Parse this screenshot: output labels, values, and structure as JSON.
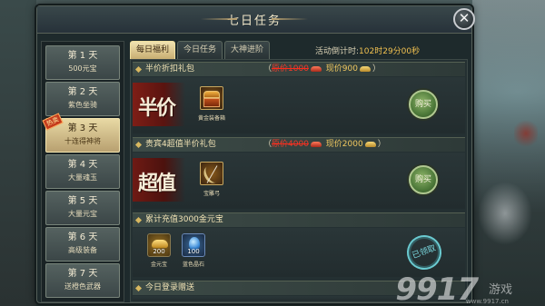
{
  "window": {
    "title": "七日任务",
    "close_symbol": "✕"
  },
  "days": [
    {
      "day": "第 1 天",
      "reward": "500元宝",
      "active": false
    },
    {
      "day": "第 2 天",
      "reward": "紫色坐骑",
      "active": false
    },
    {
      "day": "第 3 天",
      "reward": "十连得神将",
      "active": true,
      "badge": "热卖"
    },
    {
      "day": "第 4 天",
      "reward": "大量魂玉",
      "active": false
    },
    {
      "day": "第 5 天",
      "reward": "大量元宝",
      "active": false
    },
    {
      "day": "第 6 天",
      "reward": "高级装备",
      "active": false
    },
    {
      "day": "第 7 天",
      "reward": "送橙色武器",
      "active": false
    }
  ],
  "tabs": [
    {
      "label": "每日福利",
      "active": true
    },
    {
      "label": "今日任务",
      "active": false
    },
    {
      "label": "大神进阶",
      "active": false
    }
  ],
  "countdown": {
    "label": "活动倒计时:",
    "time": "102时29分00秒"
  },
  "sections": {
    "half_price": {
      "title": "半价折扣礼包",
      "paren_open": "（",
      "orig_label": "原价1000",
      "now_label": "现价900",
      "paren_close": "）",
      "big_label": "半价",
      "item_name": "黄金装备箱",
      "buy": "购买"
    },
    "super_value": {
      "title": "贵宾4超值半价礼包",
      "paren_open": "（",
      "orig_label": "原价4000",
      "now_label": "现价2000",
      "paren_close": "）",
      "big_label": "超值",
      "item_name": "宝雕弓",
      "buy": "购买"
    },
    "recharge": {
      "title": "累计充值3000金元宝",
      "items": [
        {
          "qty": "200",
          "name": "金元宝",
          "kind": "gold"
        },
        {
          "qty": "100",
          "name": "蓝色晶石",
          "kind": "blue"
        }
      ],
      "claimed": "已领取"
    },
    "login": {
      "title": "今日登录赠送"
    }
  },
  "watermark": {
    "main": "9917",
    "sub": "游戏",
    "url": "www.9917.cn"
  },
  "colors": {
    "accent_gold": "#d8b860",
    "strike_red": "#ee3c2c",
    "buy_green": "#4e7a3a",
    "claim_cyan": "#6acad0"
  }
}
